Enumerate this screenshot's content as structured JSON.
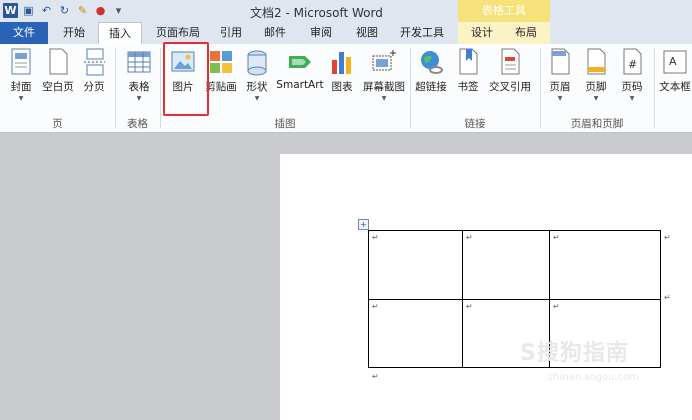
{
  "window": {
    "title": "文档2 - Microsoft Word",
    "context_tool_title": "表格工具"
  },
  "tabs": [
    {
      "label": "文件"
    },
    {
      "label": "开始"
    },
    {
      "label": "插入"
    },
    {
      "label": "页面布局"
    },
    {
      "label": "引用"
    },
    {
      "label": "邮件"
    },
    {
      "label": "审阅"
    },
    {
      "label": "视图"
    },
    {
      "label": "开发工具"
    },
    {
      "label": "设计"
    },
    {
      "label": "布局"
    }
  ],
  "ribbon": {
    "buttons": {
      "cover": "封面",
      "blank": "空白页",
      "break": "分页",
      "table": "表格",
      "picture": "图片",
      "clipart": "剪贴画",
      "shapes": "形状",
      "smartart": "SmartArt",
      "chart": "图表",
      "screenshot": "屏幕截图",
      "hyperlink": "超链接",
      "bookmark": "书签",
      "crossref": "交叉引用",
      "header": "页眉",
      "footer": "页脚",
      "pagenum": "页码",
      "textbox": "文本框"
    },
    "groups": {
      "pages": "页",
      "tables": "表格",
      "illustrations": "插图",
      "links": "链接",
      "header_footer": "页眉和页脚"
    }
  },
  "document": {
    "para_mark": "↵",
    "table_handle": "+"
  },
  "watermark": {
    "text": "S搜狗指南",
    "url": "zhinan.sogou.com"
  }
}
